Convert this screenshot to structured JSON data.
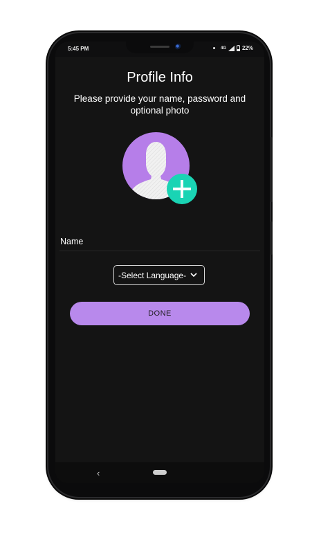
{
  "status_bar": {
    "time": "5:45 PM",
    "network": "4G",
    "battery": "22%"
  },
  "page": {
    "title": "Profile Info",
    "subtitle": "Please provide your name, password and optional photo"
  },
  "avatar": {
    "icon": "person-silhouette-icon",
    "add_icon": "plus-icon"
  },
  "form": {
    "name_label": "Name",
    "language_select": {
      "selected": "-Select Language-",
      "icon": "chevron-down-icon"
    },
    "done_label": "DONE"
  },
  "navigation": {
    "back_glyph": "‹"
  },
  "colors": {
    "background": "#141414",
    "accent_purple": "#b889ec",
    "avatar_purple": "#b67ee9",
    "add_button_teal": "#1ad4b4"
  }
}
